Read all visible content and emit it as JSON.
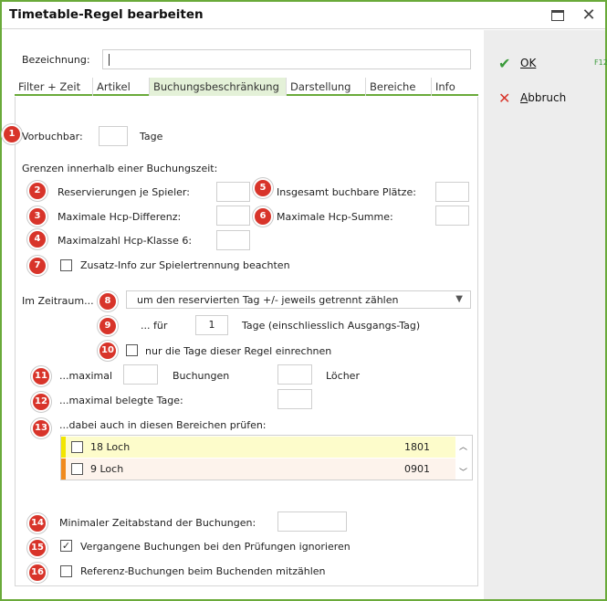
{
  "window": {
    "title": "Timetable-Regel bearbeiten"
  },
  "actions": {
    "ok": {
      "label": "OK",
      "shortcut": "F12"
    },
    "cancel": {
      "label": "Abbruch"
    }
  },
  "bezeichnung": {
    "label": "Bezeichnung:",
    "value": ""
  },
  "tabs": [
    {
      "label": "Filter + Zeit"
    },
    {
      "label": "Artikel"
    },
    {
      "label": "Buchungsbeschränkung"
    },
    {
      "label": "Darstellung"
    },
    {
      "label": "Bereiche"
    },
    {
      "label": "Info"
    }
  ],
  "active_tab": "Buchungsbeschränkung",
  "badges": [
    "1",
    "2",
    "3",
    "4",
    "5",
    "6",
    "7",
    "8",
    "9",
    "10",
    "11",
    "12",
    "13",
    "14",
    "15",
    "16"
  ],
  "form": {
    "vorbuchbar_label": "Vorbuchbar:",
    "vorbuchbar_value": "",
    "tage": "Tage",
    "grenzen_heading": "Grenzen innerhalb einer Buchungszeit:",
    "res_je_spieler": "Reservierungen je Spieler:",
    "max_hcp_diff": "Maximale Hcp-Differenz:",
    "max_hcp_klasse6": "Maximalzahl Hcp-Klasse 6:",
    "insgesamt_plaetze": "Insgesamt buchbare Plätze:",
    "max_hcp_summe": "Maximale Hcp-Summe:",
    "zusatz_info": "Zusatz-Info zur Spielertrennung beachten",
    "im_zeitraum": "Im Zeitraum...",
    "zeitraum_option": "um den reservierten Tag +/- jeweils getrennt zählen",
    "fuer": "... für",
    "fuer_value": "1",
    "tage_einschl": "Tage (einschliesslich Ausgangs-Tag)",
    "nur_tage_regel": "nur die Tage dieser Regel einrechnen",
    "maximal": "...maximal",
    "buchungen": "Buchungen",
    "loecher": "Löcher",
    "maximal_belegte": "...maximal belegte Tage:",
    "dabei_bereiche": "...dabei auch in diesen Bereichen prüfen:",
    "min_zeitabstand": "Minimaler Zeitabstand der Buchungen:",
    "vergangene": "Vergangene Buchungen bei den Prüfungen ignorieren",
    "vergangene_checked": true,
    "referenz": "Referenz-Buchungen beim Buchenden mitzählen",
    "checkmark": "✓"
  },
  "areas": [
    {
      "name": "18 Loch",
      "code": "1801",
      "color": "#f2e600",
      "bg": "#fdfccb"
    },
    {
      "name": "9 Loch",
      "code": "0901",
      "color": "#f08a1e",
      "bg": "#fdf3ec"
    }
  ],
  "icons": {
    "ok": "check-icon",
    "cancel": "x-icon",
    "maximize": "maximize-icon",
    "close": "close-icon"
  },
  "colors": {
    "accent": "#6aaa3a",
    "badge": "#d8342a",
    "ok_green": "#3a9a3a",
    "cancel_red": "#d8342a"
  }
}
